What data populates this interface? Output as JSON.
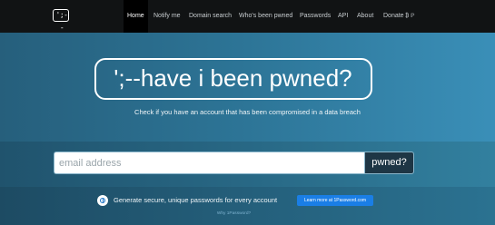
{
  "nav": {
    "logo_text": "';--",
    "items": [
      {
        "label": "Home",
        "active": true
      },
      {
        "label": "Notify me"
      },
      {
        "label": "Domain search"
      },
      {
        "label": "Who's been pwned"
      },
      {
        "label": "Passwords"
      },
      {
        "label": "API"
      },
      {
        "label": "About"
      },
      {
        "label": "Donate"
      }
    ],
    "donate_icons": "₿ ℙ"
  },
  "hero": {
    "title": "';--have i been pwned?",
    "tagline": "Check if you have an account that has been compromised in a data breach"
  },
  "search": {
    "placeholder": "email address",
    "value": "",
    "button_label": "pwned?"
  },
  "promo": {
    "text": "Generate secure, unique passwords for every account",
    "button_label": "Learn more at 1Password.com",
    "link": "Why 1Password?"
  },
  "colors": {
    "navbar": "#111314",
    "hero_accent": "#2d7597",
    "search_button": "#1e3645",
    "promo_button": "#1a7ee6"
  }
}
